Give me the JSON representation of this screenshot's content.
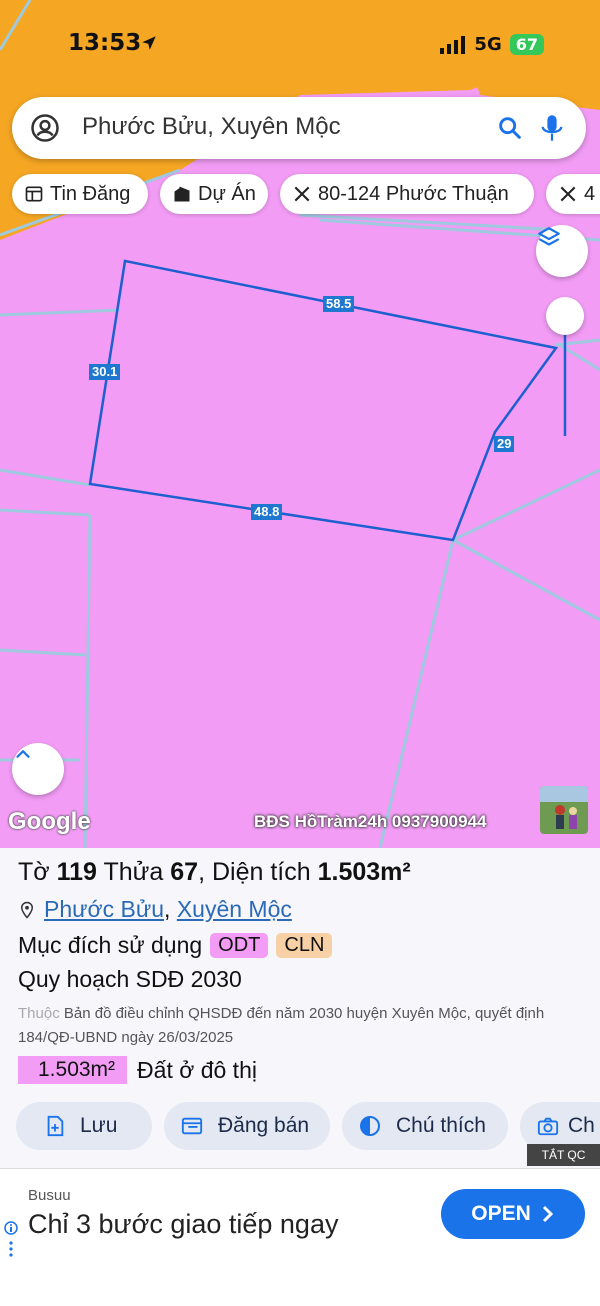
{
  "status_bar": {
    "time": "13:53",
    "network": "5G",
    "battery": "67"
  },
  "search": {
    "query": "Phước Bửu, Xuyên Mộc"
  },
  "chips": [
    {
      "label": "Tin Đăng",
      "icon": "listing-icon"
    },
    {
      "label": "Dự Án",
      "icon": "project-icon"
    },
    {
      "label": "80-124 Phước Thuận",
      "icon": "measure-icon"
    },
    {
      "label": "4",
      "icon": "measure-icon"
    }
  ],
  "map": {
    "parcel_dimensions": {
      "top": "58.5",
      "left": "30.1",
      "right": "29",
      "bottom": "48.8"
    },
    "google_logo": "Google",
    "watermark": "BĐS HồTràm24h 0937900944",
    "colors": {
      "land_residential": "#f29cf5",
      "land_orange": "#f5a623",
      "parcel_line": "#1e5fd0",
      "boundary": "#9ec9df"
    }
  },
  "parcel": {
    "title_to": "Tờ",
    "sheet_no": "119",
    "title_thua": "Thửa",
    "parcel_no": "67",
    "title_area": "Diện tích",
    "area": "1.503m²",
    "ward": "Phước Bửu",
    "district": "Xuyên Mộc",
    "purpose_label": "Mục đích sử dụng",
    "purpose_tags": [
      "ODT",
      "CLN"
    ],
    "plan_label": "Quy hoạch SDĐ 2030",
    "desc_prefix": "Thuộc",
    "desc_text": "Bản đồ điều chỉnh QHSDĐ đến năm 2030 huyện Xuyên Mộc, quyết định 184/QĐ-UBND ngày 26/03/2025",
    "area_badge": "1.503m²",
    "area_type": "Đất ở đô thị"
  },
  "actions": [
    {
      "label": "Lưu",
      "icon": "save-icon"
    },
    {
      "label": "Đăng bán",
      "icon": "post-sale-icon"
    },
    {
      "label": "Chú thích",
      "icon": "legend-icon"
    },
    {
      "label": "Ch",
      "icon": "camera-icon"
    }
  ],
  "ad": {
    "label": "TẮT QC",
    "advertiser": "Busuu",
    "headline": "Chỉ 3 bước giao tiếp ngay",
    "cta": "OPEN"
  }
}
